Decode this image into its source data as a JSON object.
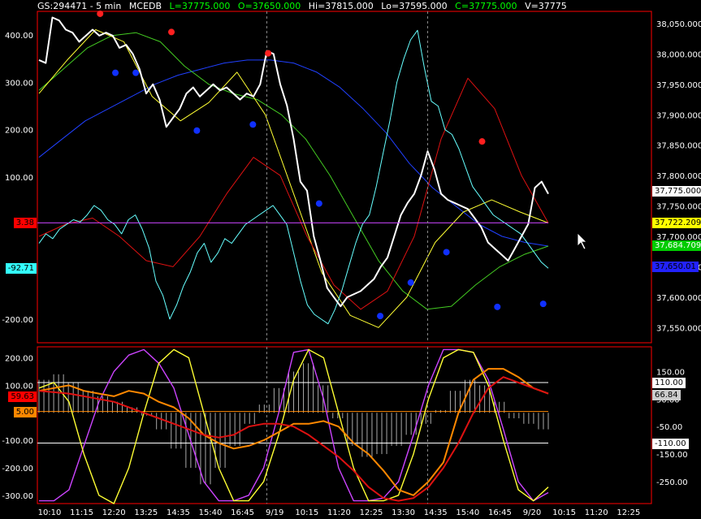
{
  "header": {
    "symbol": "GS:294471 - 5 min",
    "study": "MCEDB",
    "last": "L=37775.000",
    "open": "O=37650.000",
    "high": "Hi=37815.000",
    "low": "Lo=37595.000",
    "close": "C=37775.000",
    "volume": "V=37775"
  },
  "colors": {
    "background": "#000000",
    "frame": "#ff0000",
    "price": "#ffffff",
    "cyan": "#66ffff",
    "blue": "#2040ff",
    "green": "#44cc22",
    "yellow": "#ffff33",
    "red": "#dd1111",
    "magenta": "#cc44ff",
    "orange": "#ff8800"
  },
  "upper_panel": {
    "left_ticks": [
      "400.00",
      "300.00",
      "200.00",
      "100.00",
      "-200.00"
    ],
    "right_ticks": [
      "38,050.000",
      "38,000.000",
      "37,950.000",
      "37,900.000",
      "37,850.000",
      "37,800.000",
      "37,750.000",
      "37,700.000",
      "37,650.000",
      "37,600.000",
      "37,550.000"
    ],
    "left_tags": [
      {
        "text": "3.38",
        "bg": "#ff0000",
        "fg": "#000000"
      },
      {
        "text": "-92.71",
        "bg": "#33ffff",
        "fg": "#000000"
      }
    ],
    "right_tags": [
      {
        "text": "37,775.000",
        "bg": "#ffffff",
        "fg": "#000000"
      },
      {
        "text": "37,722.209",
        "bg": "#ffff00",
        "fg": "#000000"
      },
      {
        "text": "37,684.709",
        "bg": "#00cc00",
        "fg": "#ffffff"
      },
      {
        "text": "37,650.01",
        "bg": "#2222ff",
        "fg": "#000000"
      }
    ]
  },
  "lower_panel": {
    "left_ticks": [
      "200.00",
      "100.00",
      "-100.00",
      "-200.00",
      "-300.00"
    ],
    "right_ticks": [
      "150.00",
      "50.00",
      "-50.00",
      "-150.00",
      "-250.00"
    ],
    "left_tags": [
      {
        "text": "59.63",
        "bg": "#ff0000",
        "fg": "#000000"
      },
      {
        "text": "5.00",
        "bg": "#ff8800",
        "fg": "#000000"
      }
    ],
    "right_tags": [
      {
        "text": "110.00",
        "bg": "#ffffff",
        "fg": "#000000"
      },
      {
        "text": "66.84",
        "bg": "#cccccc",
        "fg": "#000000"
      },
      {
        "text": "-110.00",
        "bg": "#ffffff",
        "fg": "#000000"
      }
    ]
  },
  "time_axis": [
    "10:10",
    "11:15",
    "12:20",
    "13:25",
    "14:35",
    "15:40",
    "16:45",
    "9/19",
    "10:15",
    "11:20",
    "12:25",
    "13:30",
    "14:35",
    "15:40",
    "16:45",
    "9/20",
    "10:15",
    "11:20",
    "12:25"
  ],
  "chart_data": [
    {
      "type": "line",
      "title": "GS:294471 - 5 min MCEDB",
      "y_right_range": [
        37525,
        38070
      ],
      "y_left_range": [
        -250,
        450
      ],
      "series": [
        {
          "values": [
            37990,
            37985,
            38060,
            38055,
            38040,
            38035,
            38020,
            38030,
            38040,
            38030,
            38035,
            38030,
            38010,
            38015,
            38000,
            37975,
            37935,
            37950,
            37925,
            37880,
            37895,
            37910,
            37935,
            37945,
            37930,
            37940,
            37950,
            37940,
            37945,
            37935,
            37925,
            37935,
            37930,
            37950,
            38005,
            38000,
            37950,
            37915,
            37860,
            37790,
            37775,
            37700,
            37660,
            37615,
            37600,
            37585,
            37600,
            37605,
            37610,
            37620,
            37630,
            37650,
            37665,
            37700,
            37735,
            37755,
            37770,
            37800,
            37840,
            37810,
            37770,
            37760,
            37755,
            37750,
            37745,
            37730,
            37715,
            37690,
            37680,
            37670,
            37660,
            37680,
            37700,
            37720,
            37780,
            37790,
            37770
          ]
        },
        {
          "values": [
            -40,
            -20,
            -30,
            -10,
            0,
            10,
            5,
            20,
            40,
            30,
            10,
            0,
            -20,
            10,
            20,
            -10,
            -50,
            -120,
            -150,
            -200,
            -170,
            -130,
            -100,
            -60,
            -40,
            -80,
            -60,
            -30,
            -40,
            -20,
            0,
            10,
            20,
            30,
            40,
            20,
            0,
            -60,
            -120,
            -170,
            -190,
            -200,
            -210,
            -180,
            -140,
            -90,
            -40,
            0,
            20,
            80,
            150,
            220,
            300,
            350,
            390,
            410,
            330,
            260,
            250,
            200,
            190,
            160,
            120,
            80,
            60,
            40,
            20,
            10,
            0,
            -10,
            -20,
            -40,
            -60,
            -80,
            -92.71
          ]
        },
        {
          "name": "blue",
          "values": [
            37830,
            37860,
            37890,
            37910,
            37930,
            37950,
            37965,
            37975,
            37985,
            37990,
            37990,
            37985,
            37970,
            37945,
            37910,
            37870,
            37820,
            37780,
            37750,
            37720,
            37700,
            37690,
            37684
          ]
        },
        {
          "name": "green",
          "values": [
            37940,
            37975,
            38010,
            38030,
            38035,
            38020,
            37980,
            37950,
            37935,
            37925,
            37900,
            37860,
            37800,
            37730,
            37660,
            37610,
            37580,
            37585,
            37620,
            37650,
            37670,
            37684
          ]
        },
        {
          "name": "yellow",
          "values": [
            37935,
            37990,
            38040,
            38020,
            37930,
            37890,
            37920,
            37970,
            37900,
            37770,
            37640,
            37570,
            37550,
            37600,
            37690,
            37740,
            37760,
            37740,
            37722
          ]
        },
        {
          "name": "red",
          "values": [
            37700,
            37720,
            37730,
            37700,
            37660,
            37650,
            37700,
            37770,
            37830,
            37800,
            37700,
            37620,
            37580,
            37610,
            37700,
            37860,
            37960,
            37910,
            37800,
            37722
          ]
        }
      ],
      "markers_up": [
        [
          "12",
          38050
        ],
        [
          "26",
          38020
        ],
        [
          "45",
          37985
        ],
        [
          "87",
          37840
        ]
      ],
      "markers_down": [
        [
          "15",
          37985
        ],
        [
          "19",
          37985
        ],
        [
          "31",
          37890
        ],
        [
          "42",
          37900
        ],
        [
          "55",
          37770
        ],
        [
          "67",
          37585
        ],
        [
          "73",
          37640
        ],
        [
          "80",
          37690
        ],
        [
          "90",
          37600
        ],
        [
          "99",
          37605
        ]
      ]
    },
    {
      "type": "line",
      "title": "",
      "ylim": [
        -330,
        240
      ],
      "series": [
        {
          "name": "magenta",
          "values": [
            -320,
            -320,
            -280,
            -120,
            40,
            150,
            210,
            230,
            180,
            90,
            -80,
            -250,
            -320,
            -320,
            -300,
            -200,
            0,
            220,
            230,
            50,
            -200,
            -320,
            -320,
            -310,
            -250,
            -80,
            100,
            230,
            230,
            220,
            120,
            -60,
            -250,
            -320,
            -290
          ]
        },
        {
          "name": "yellow",
          "values": [
            90,
            110,
            40,
            -150,
            -300,
            -330,
            -200,
            0,
            180,
            230,
            200,
            0,
            -200,
            -320,
            -320,
            -250,
            -80,
            120,
            230,
            200,
            0,
            -200,
            -320,
            -320,
            -300,
            -150,
            50,
            200,
            230,
            220,
            100,
            -100,
            -280,
            -320,
            -270
          ]
        },
        {
          "name": "orange",
          "values": [
            80,
            90,
            100,
            80,
            70,
            60,
            80,
            70,
            40,
            20,
            -20,
            -80,
            -110,
            -130,
            -120,
            -100,
            -70,
            -40,
            -40,
            -30,
            -50,
            -110,
            -150,
            -210,
            -280,
            -300,
            -250,
            -180,
            0,
            120,
            160,
            160,
            130,
            90,
            70
          ]
        },
        {
          "name": "red",
          "values": [
            80,
            75,
            70,
            60,
            50,
            40,
            20,
            0,
            -20,
            -40,
            -60,
            -80,
            -90,
            -80,
            -50,
            -40,
            -40,
            -50,
            -80,
            -120,
            -160,
            -210,
            -270,
            -310,
            -320,
            -310,
            -270,
            -200,
            -110,
            0,
            90,
            130,
            110,
            90,
            70
          ]
        },
        {
          "name": "histogram",
          "values": [
            120,
            140,
            110,
            80,
            60,
            40,
            20,
            -10,
            -60,
            -130,
            -200,
            -260,
            -200,
            -120,
            -40,
            30,
            90,
            150,
            180,
            100,
            -20,
            -120,
            -160,
            -150,
            -120,
            -80,
            -40,
            10,
            80,
            120,
            100,
            40,
            -20,
            -40,
            -60
          ]
        },
        {
          "name": "reference",
          "values": [
            110,
            5,
            -110
          ]
        }
      ]
    }
  ]
}
